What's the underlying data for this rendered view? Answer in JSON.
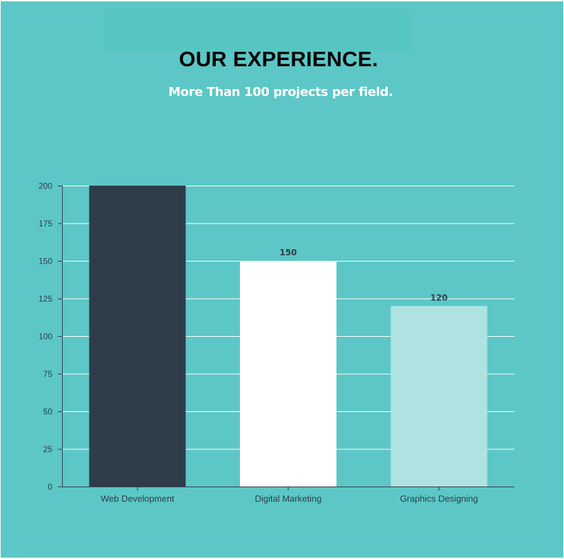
{
  "header": {
    "title": "OUR EXPERIENCE.",
    "subtitle": "More Than 100 projects per field."
  },
  "colors": {
    "background": "#5cc7c6",
    "gridline": "#ffffff",
    "axis": "#2f3d4a"
  },
  "chart_data": {
    "type": "bar",
    "title": "",
    "xlabel": "",
    "ylabel": "",
    "categories": [
      "Web Development",
      "Digital Marketing",
      "Graphics Designing"
    ],
    "values": [
      200,
      150,
      120
    ],
    "bar_colors": [
      "#2f3d4a",
      "#ffffff",
      "#aee3e2"
    ],
    "data_labels": [
      "",
      "150",
      "120"
    ],
    "ylim": [
      0,
      200
    ],
    "yticks": [
      0,
      25,
      50,
      75,
      100,
      125,
      150,
      175,
      200
    ],
    "grid": true,
    "legend": "none"
  }
}
